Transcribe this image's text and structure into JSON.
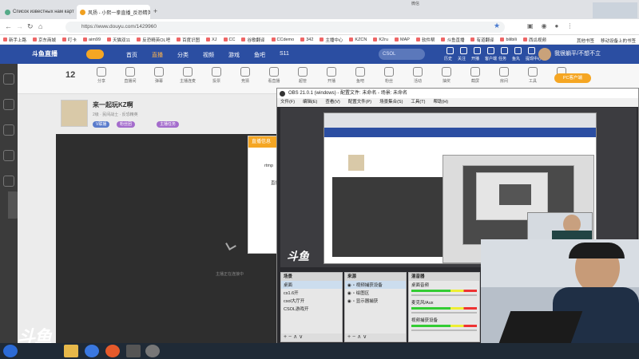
{
  "browser": {
    "tabs": [
      {
        "label": "Список известных нам карт"
      },
      {
        "label": "风扬 - 小熙一拳直播_反恐精英"
      }
    ],
    "new_tab_symbol": "+",
    "close_symbol": "×",
    "window_label": "微信",
    "url": "https://www.douyu.com/1429960",
    "bookmarks": [
      "新手上路",
      "京东商城",
      "叮卡",
      "aim99",
      "天猫双11",
      "反恐精英OL吧",
      "百度识图",
      "XJ",
      "CC",
      "谷歌翻译",
      "CCdemo",
      "342",
      "主播中心",
      "KZCN",
      "K2ru",
      "MAP",
      "软件帮",
      "斗鱼直播",
      "有道翻译",
      "bilibili",
      "西瓜视频"
    ],
    "bookmark_right": [
      "其他书签",
      "移动设备上的书签"
    ]
  },
  "site": {
    "logo_text": "斗鱼直播",
    "nav": [
      "首页",
      "直播",
      "分类",
      "视频",
      "游戏",
      "鱼吧",
      "S11"
    ],
    "nav_active_index": 1,
    "search_placeholder": "CSOL",
    "header_right": [
      "历史",
      "关注",
      "开播",
      "客户端",
      "任务",
      "鱼丸",
      "提现中心"
    ],
    "user_name": "我很躺平/不想不立"
  },
  "toolbar": {
    "count": "12",
    "tools": [
      "分享",
      "直播间",
      "弹幕",
      "主播连麦",
      "投票",
      "竞猜",
      "看直播",
      "超管",
      "开播",
      "鱼吧",
      "粉丝",
      "活动",
      "抽奖",
      "截屏",
      "房间",
      "工具",
      "设置"
    ],
    "right_button": "PC客户端"
  },
  "anchor": {
    "room_title": "来一起玩KZ啊",
    "meta": "2级 · 民间战士 · 反恐精英",
    "pills": [
      "V联播",
      "粉丝团",
      "主播任务"
    ]
  },
  "loading_panel": {
    "header": "直播信息",
    "lines": [
      "rtmp",
      "直播..."
    ]
  },
  "player": {
    "hint": "主播正在连接中"
  },
  "obs": {
    "title": "OBS 21.0.1 (windows) - 配置文件: 未命名 - 场景: 未命名",
    "menu": [
      "文件(F)",
      "编辑(E)",
      "查看(V)",
      "配置文件(P)",
      "场景集合(S)",
      "工具(T)",
      "帮助(H)"
    ],
    "scenes_header": "场景",
    "scenes": [
      "桌面",
      "cs1.6开",
      "csol大厅开",
      "CSOL游戏开"
    ],
    "sources_header": "来源",
    "sources": [
      "视频捕获设备",
      "绘图区",
      "显示器捕获"
    ],
    "mixer_header": "混音器",
    "mixer": [
      "桌面音频",
      "麦克风/Aux",
      "视频捕获设备"
    ],
    "dock_footer": "+ −  ∧ ∨"
  },
  "watermark": "斗鱼",
  "colors": {
    "site_header": "#2b4ea2",
    "accent": "#f5a623",
    "obs_bg": "#2a2a2e"
  }
}
